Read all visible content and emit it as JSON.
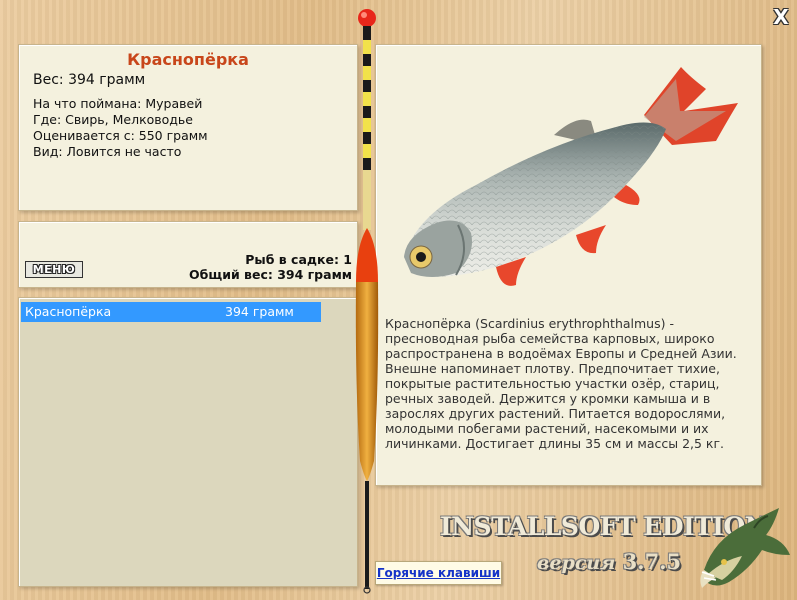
{
  "window": {
    "close_label": "X"
  },
  "fish": {
    "name": "Краснопёрка",
    "weight": "Вес: 394 грамм",
    "bait": "На что поймана: Муравей",
    "location": "Где: Свирь, Мелководье",
    "value": "Оценивается с: 550 грамм",
    "rarity": "Вид: Ловится не часто"
  },
  "status": {
    "menu_label": "МЕНЮ",
    "fish_count": "Рыб в садке: 1",
    "total_weight": "Общий вес: 394 грамм"
  },
  "catch_list": [
    {
      "name": "Краснопёрка",
      "weight": "394 грамм"
    }
  ],
  "description": "Краснопёрка (Scardinius erythrophthalmus) - пресноводная рыба семейства карповых, широко распространена в водоёмах Европы и Средней Азии. Внешне напоминает плотву. Предпочитает тихие, покрытые растительностью участки озёр, стариц, речных заводей. Держится у кромки камыша и в зарослях других растений. Питается водорослями, молодыми побегами растений, насекомыми и их личинками. Достигает длины 35 см и массы 2,5 кг.",
  "footer": {
    "hotkeys_label": "Горячие клавиши",
    "brand": "INSTALLSOFT EDITION",
    "version_word": "версия",
    "version_number": "3.7.5"
  },
  "icons": {
    "close": "close-icon",
    "float": "fishing-float-icon",
    "pike": "pike-logo-icon",
    "fish_photo": "rudd-fish-image"
  },
  "colors": {
    "title": "#c8461a",
    "selection": "#3399ff",
    "link": "#1533c8",
    "panel": "#f4f1de"
  }
}
